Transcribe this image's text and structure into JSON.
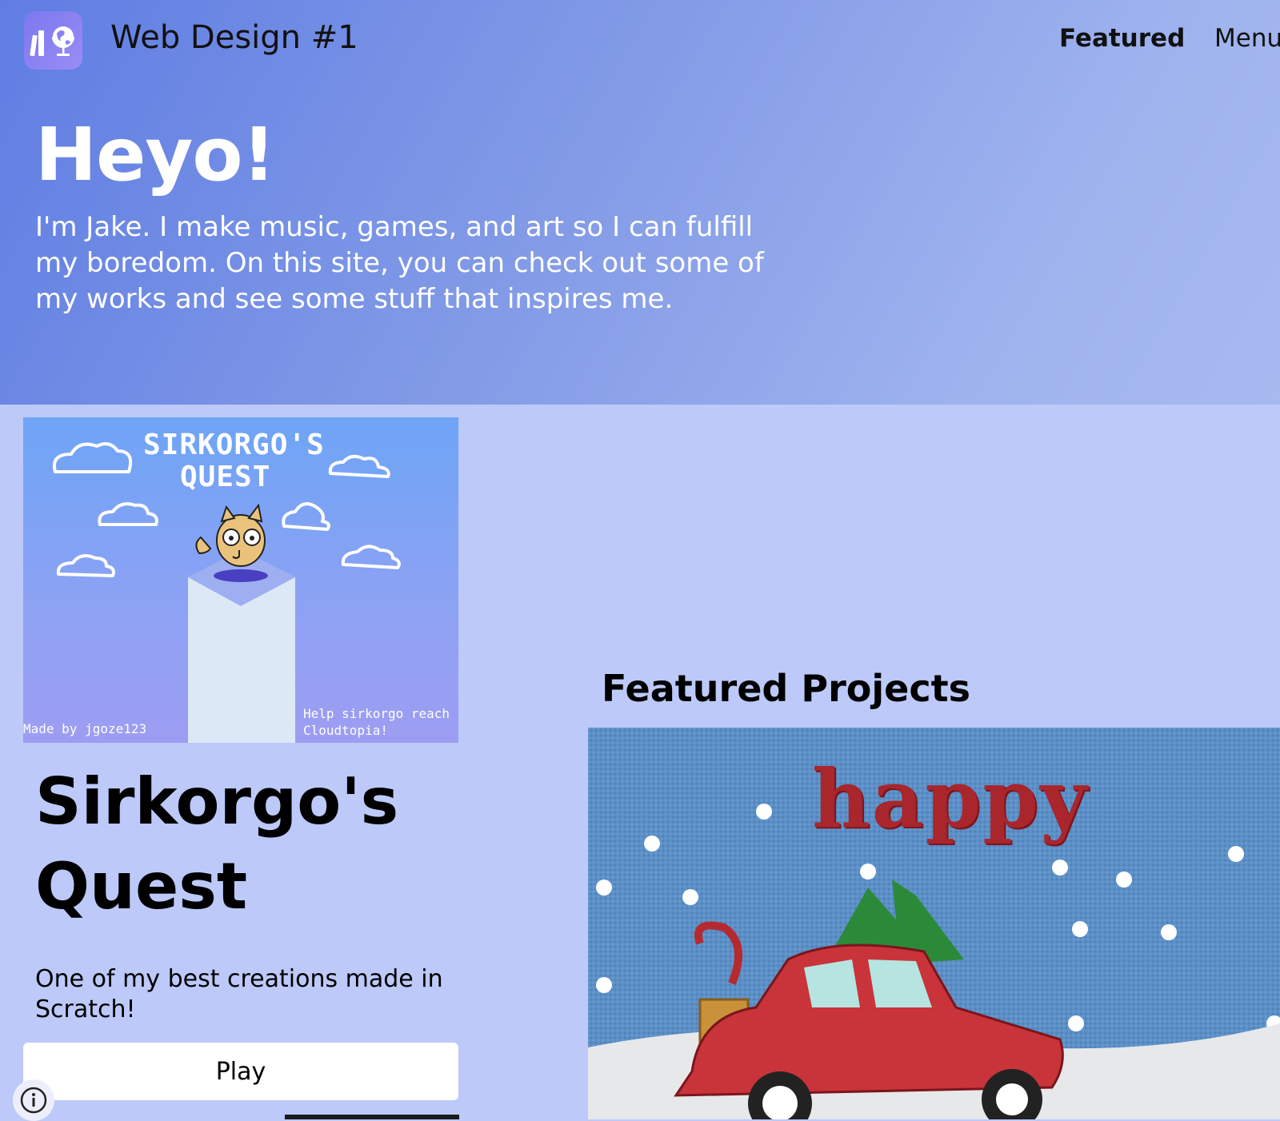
{
  "header": {
    "site_title": "Web Design #1",
    "nav": {
      "featured": "Featured",
      "menu": "Menu"
    }
  },
  "hero": {
    "heading": "Heyo!",
    "text": "I'm Jake. I make music, games, and art so I can fulfill my boredom. On this site, you can check out some of my works and see some stuff that inspires me."
  },
  "project": {
    "cover": {
      "title_line1": "SIRKORGO'S",
      "title_line2": "QUEST",
      "credit": "Made by jgoze123",
      "help": "Help sirkorgo reach Cloudtopia!"
    },
    "title": "Sirkorgo's Quest",
    "description": "One of my best creations made in Scratch!",
    "play_label": "Play"
  },
  "featured": {
    "heading": "Featured Projects",
    "card_word": "happy"
  },
  "icons": {
    "logo": "books-globe-icon",
    "info": "info-icon"
  },
  "colors": {
    "hero_gradient_start": "#5f7de3",
    "hero_gradient_end": "#a7b9ef",
    "page_background": "#bdc9f8",
    "logo_background": "#8a82f1",
    "play_button": "#ffffff"
  }
}
